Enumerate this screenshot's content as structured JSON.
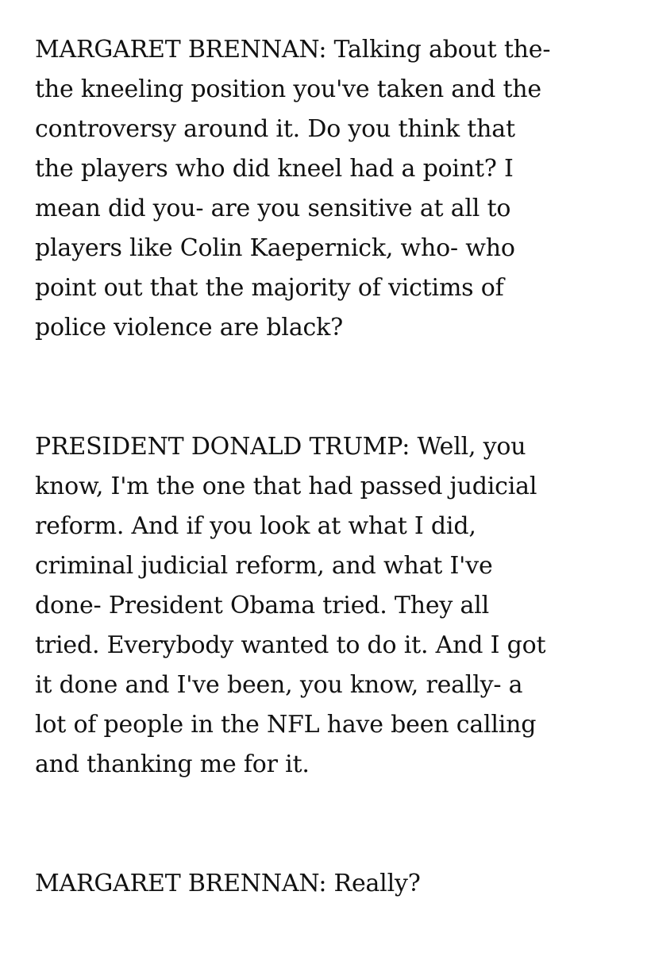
{
  "transcript": {
    "paragraphs": [
      {
        "lines": [
          "MARGARET BRENNAN: Talking about the-",
          "the kneeling position you've taken and the",
          "controversy around it. Do you think that",
          "the players who did kneel had a point? I",
          "mean did you- are you sensitive at all to",
          "players like Colin Kaepernick, who- who",
          "point out that the majority of victims of",
          "police violence are black?"
        ]
      },
      {
        "lines": [
          "PRESIDENT DONALD TRUMP: Well, you",
          "know, I'm the one that had passed judicial",
          "reform. And if you look at what I did,",
          "criminal judicial reform, and what I've",
          "done- President Obama tried. They all",
          "tried. Everybody wanted to do it. And I got",
          "it done and I've been, you know, really- a",
          "lot of people in the NFL have been calling",
          "and thanking me for it."
        ]
      },
      {
        "lines": [
          "MARGARET BRENNAN: Really?"
        ]
      }
    ]
  }
}
